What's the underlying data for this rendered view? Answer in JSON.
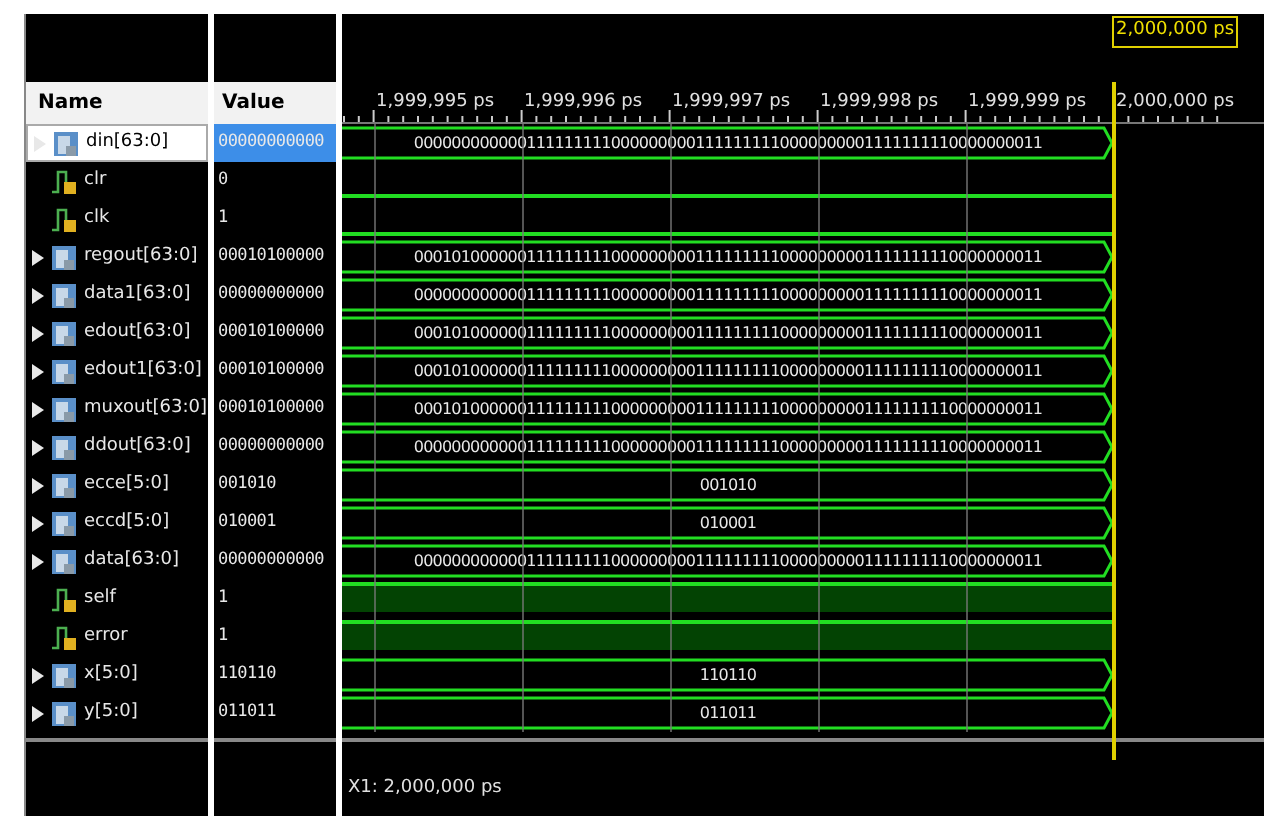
{
  "cursor": {
    "label": "2,000,000 ps"
  },
  "columns": {
    "name": "Name",
    "value": "Value"
  },
  "ruler": {
    "ticks": [
      "1,999,995 ps",
      "1,999,996 ps",
      "1,999,997 ps",
      "1,999,998 ps",
      "1,999,999 ps",
      "2,000,000 ps"
    ]
  },
  "signals": [
    {
      "kind": "bus",
      "name": "din[63:0]",
      "value": "00000000000",
      "wave_text": "0000000000001111111110000000001111111110000000001111111110000000011",
      "selected": true
    },
    {
      "kind": "bit",
      "name": "clr",
      "value": "0",
      "high": false,
      "selected": false
    },
    {
      "kind": "bit",
      "name": "clk",
      "value": "1",
      "high": false,
      "selected": false
    },
    {
      "kind": "bus",
      "name": "regout[63:0]",
      "value": "00010100000",
      "wave_text": "0001010000001111111110000000001111111110000000001111111110000000011",
      "selected": false
    },
    {
      "kind": "bus",
      "name": "data1[63:0]",
      "value": "00000000000",
      "wave_text": "0000000000001111111110000000001111111110000000001111111110000000011",
      "selected": false
    },
    {
      "kind": "bus",
      "name": "edout[63:0]",
      "value": "00010100000",
      "wave_text": "0001010000001111111110000000001111111110000000001111111110000000011",
      "selected": false
    },
    {
      "kind": "bus",
      "name": "edout1[63:0]",
      "value": "00010100000",
      "wave_text": "0001010000001111111110000000001111111110000000001111111110000000011",
      "selected": false
    },
    {
      "kind": "bus",
      "name": "muxout[63:0]",
      "value": "00010100000",
      "wave_text": "0001010000001111111110000000001111111110000000001111111110000000011",
      "selected": false
    },
    {
      "kind": "bus",
      "name": "ddout[63:0]",
      "value": "00000000000",
      "wave_text": "0000000000001111111110000000001111111110000000001111111110000000011",
      "selected": false
    },
    {
      "kind": "bus",
      "name": "ecce[5:0]",
      "value": "001010",
      "wave_text": "001010",
      "selected": false
    },
    {
      "kind": "bus",
      "name": "eccd[5:0]",
      "value": "010001",
      "wave_text": "010001",
      "selected": false
    },
    {
      "kind": "bus",
      "name": "data[63:0]",
      "value": "00000000000",
      "wave_text": "0000000000001111111110000000001111111110000000001111111110000000011",
      "selected": false
    },
    {
      "kind": "bit",
      "name": "self",
      "value": "1",
      "high": true,
      "selected": false
    },
    {
      "kind": "bit",
      "name": "error",
      "value": "1",
      "high": true,
      "selected": false
    },
    {
      "kind": "bus",
      "name": "x[5:0]",
      "value": "110110",
      "wave_text": "110110",
      "selected": false
    },
    {
      "kind": "bus",
      "name": "y[5:0]",
      "value": "011011",
      "wave_text": "011011",
      "selected": false
    }
  ],
  "footer": {
    "cursor_readout": "X1: 2,000,000 ps"
  }
}
